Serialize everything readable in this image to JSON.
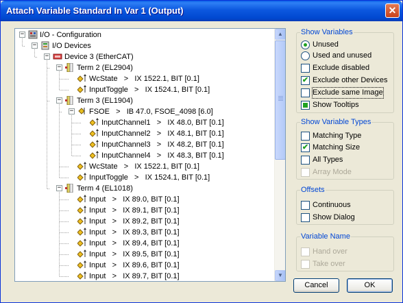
{
  "window": {
    "title": "Attach Variable Standard In Var 1 (Output)",
    "close_glyph": "✕"
  },
  "tree": {
    "rows": [
      {
        "label": "I/O - Configuration",
        "icon": "io-config-icon"
      },
      {
        "label": "I/O Devices",
        "icon": "io-devices-icon"
      },
      {
        "label": "Device 3 (EtherCAT)",
        "icon": "ethercat-device-icon"
      },
      {
        "label": "Term 2 (EL2904)",
        "icon": "terminal-icon"
      },
      {
        "label": "WcState   >   IX 1522.1, BIT [0.1]",
        "icon": "variable-icon"
      },
      {
        "label": "InputToggle   >   IX 1524.1, BIT [0.1]",
        "icon": "variable-icon"
      },
      {
        "label": "Term 3 (EL1904)",
        "icon": "terminal-icon"
      },
      {
        "label": "FSOE   >   IB 47.0, FSOE_4098 [6.0]",
        "icon": "variable-group-icon"
      },
      {
        "label": "InputChannel1   >   IX 48.0, BIT [0.1]",
        "icon": "variable-icon"
      },
      {
        "label": "InputChannel2   >   IX 48.1, BIT [0.1]",
        "icon": "variable-icon"
      },
      {
        "label": "InputChannel3   >   IX 48.2, BIT [0.1]",
        "icon": "variable-icon"
      },
      {
        "label": "InputChannel4   >   IX 48.3, BIT [0.1]",
        "icon": "variable-icon"
      },
      {
        "label": "WcState   >   IX 1522.1, BIT [0.1]",
        "icon": "variable-icon"
      },
      {
        "label": "InputToggle   >   IX 1524.1, BIT [0.1]",
        "icon": "variable-icon"
      },
      {
        "label": "Term 4 (EL1018)",
        "icon": "terminal-icon"
      },
      {
        "label": "Input   >   IX 89.0, BIT [0.1]",
        "icon": "variable-icon"
      },
      {
        "label": "Input   >   IX 89.1, BIT [0.1]",
        "icon": "variable-icon"
      },
      {
        "label": "Input   >   IX 89.2, BIT [0.1]",
        "icon": "variable-icon"
      },
      {
        "label": "Input   >   IX 89.3, BIT [0.1]",
        "icon": "variable-icon"
      },
      {
        "label": "Input   >   IX 89.4, BIT [0.1]",
        "icon": "variable-icon"
      },
      {
        "label": "Input   >   IX 89.5, BIT [0.1]",
        "icon": "variable-icon"
      },
      {
        "label": "Input   >   IX 89.6, BIT [0.1]",
        "icon": "variable-icon"
      },
      {
        "label": "Input   >   IX 89.7, BIT [0.1]",
        "icon": "variable-icon"
      }
    ],
    "expander_minus": "−",
    "scroll_up": "▲",
    "scroll_down": "▼"
  },
  "show_variables": {
    "title": "Show Variables",
    "unused": {
      "label": "Unused",
      "selected": true
    },
    "used_and_unused": {
      "label": "Used and unused",
      "selected": false
    },
    "exclude_disabled": {
      "label": "Exclude disabled",
      "checked": false
    },
    "exclude_other_devices": {
      "label": "Exclude other Devices",
      "checked": true
    },
    "exclude_same_image": {
      "label": "Exclude same Image",
      "checked": false
    },
    "show_tooltips": {
      "label": "Show Tooltips",
      "checked": "indeterminate"
    }
  },
  "show_variable_types": {
    "title": "Show Variable Types",
    "matching_type": {
      "label": "Matching Type",
      "checked": false
    },
    "matching_size": {
      "label": "Matching Size",
      "checked": true
    },
    "all_types": {
      "label": "All Types",
      "checked": false
    },
    "array_mode": {
      "label": "Array Mode",
      "checked": false,
      "disabled": true
    }
  },
  "offsets": {
    "title": "Offsets",
    "continuous": {
      "label": "Continuous",
      "checked": false
    },
    "show_dialog": {
      "label": "Show Dialog",
      "checked": false
    }
  },
  "variable_name": {
    "title": "Variable Name",
    "hand_over": {
      "label": "Hand over",
      "checked": false,
      "disabled": true
    },
    "take_over": {
      "label": "Take over",
      "checked": false,
      "disabled": true
    }
  },
  "buttons": {
    "cancel": "Cancel",
    "ok": "OK"
  },
  "check_glyph": "✔"
}
